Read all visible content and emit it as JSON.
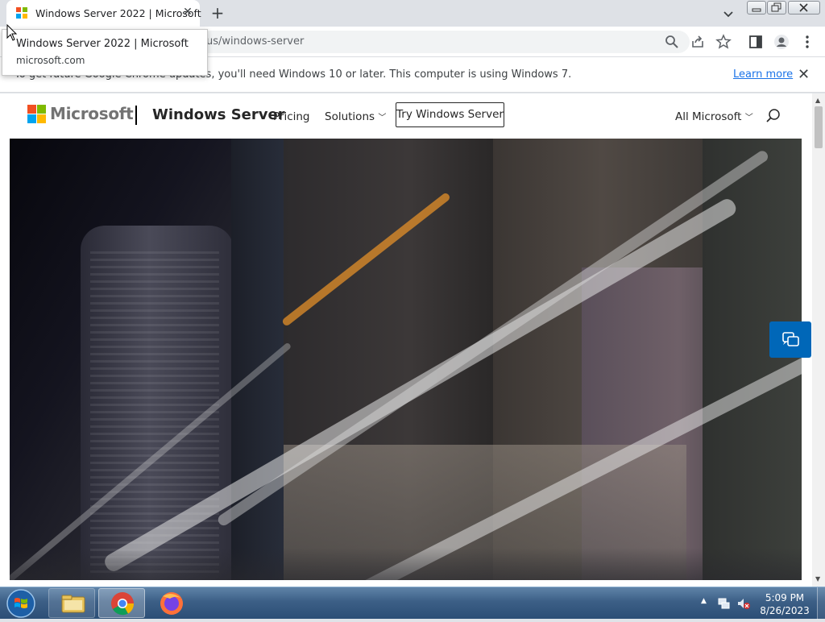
{
  "browser": {
    "tab_title": "Windows Server 2022 | Microsoft",
    "new_tab_symbol": "+",
    "url": "us/windows-server",
    "tooltip_title": "Windows Server 2022 | Microsoft",
    "tooltip_domain": "microsoft.com"
  },
  "infobar": {
    "message": "To get future Google Chrome updates, you'll need Windows 10 or later. This computer is using Windows 7.",
    "learn_more": "Learn more"
  },
  "site": {
    "brand": "Microsoft",
    "product": "Windows Server",
    "nav": {
      "pricing": "Pricing",
      "solutions": "Solutions",
      "try": "Try Windows Server",
      "all_microsoft": "All Microsoft"
    }
  },
  "taskbar": {
    "time": "5:09 PM",
    "date": "8/26/2023"
  },
  "icons": [
    "microsoft-logo-icon",
    "close-icon",
    "plus-icon",
    "chevron-down-icon",
    "search-icon",
    "share-icon",
    "star-icon",
    "sidepanel-icon",
    "profile-icon",
    "menu-icon",
    "chat-icon",
    "windows-start-icon",
    "explorer-icon",
    "chrome-icon",
    "firefox-icon",
    "network-icon",
    "volume-muted-icon",
    "tray-arrow-icon"
  ],
  "colors": {
    "ms_red": "#f25022",
    "ms_green": "#7fba00",
    "ms_blue": "#00a4ef",
    "ms_yellow": "#ffb900",
    "link_blue": "#1a73e8",
    "chat_blue": "#0067b8"
  }
}
